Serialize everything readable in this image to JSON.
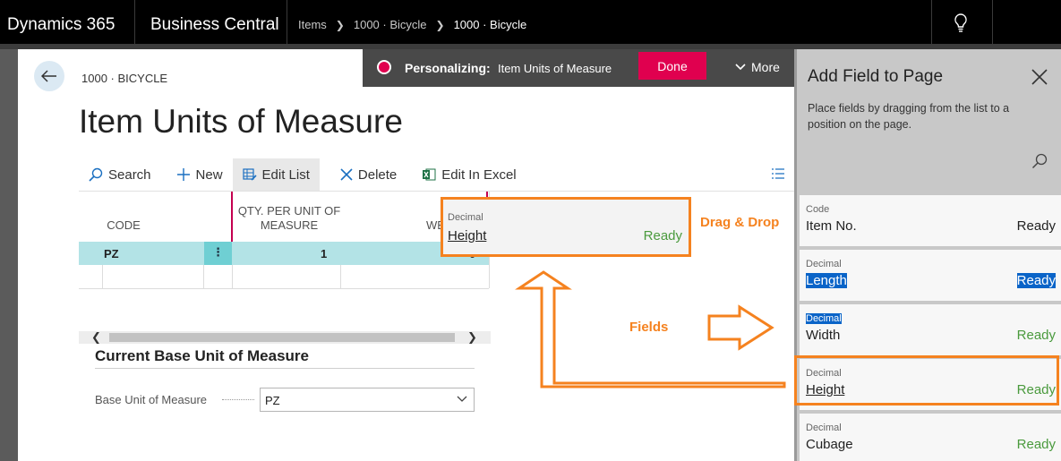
{
  "topbar": {
    "product": "Dynamics 365",
    "app": "Business Central",
    "breadcrumb": [
      "Items",
      "1000 · Bicycle",
      "1000 · Bicycle"
    ]
  },
  "personalize": {
    "label": "Personalizing:",
    "value": "Item Units of Measure",
    "done_label": "Done",
    "more_label": "More"
  },
  "page": {
    "record_id": "1000 · BICYCLE",
    "title": "Item Units of Measure"
  },
  "actions": {
    "search": "Search",
    "new": "New",
    "edit_list": "Edit List",
    "delete": "Delete",
    "edit_excel": "Edit In Excel"
  },
  "grid": {
    "headers": [
      "CODE",
      "QTY. PER UNIT OF MEASURE",
      "WEIGHT"
    ],
    "rows": [
      {
        "code": "PZ",
        "dots": "⋮",
        "qty": "1",
        "weight": "0"
      }
    ]
  },
  "drop_ghost": {
    "type": "Decimal",
    "name": "Height",
    "status": "Ready"
  },
  "fasttab": {
    "title": "Current Base Unit of Measure",
    "base_label": "Base Unit of Measure",
    "base_value": "PZ"
  },
  "panel": {
    "title": "Add Field to Page",
    "description": "Place fields by dragging from the list to a position on the page.",
    "fields": [
      {
        "type": "Code",
        "name": "Item No.",
        "status": "Ready"
      },
      {
        "type": "Decimal",
        "name": "Length",
        "status": "Ready"
      },
      {
        "type": "Decimal",
        "name": "Width",
        "status": "Ready"
      },
      {
        "type": "Decimal",
        "name": "Height",
        "status": "Ready"
      },
      {
        "type": "Decimal",
        "name": "Cubage",
        "status": "Ready"
      }
    ]
  },
  "annotations": {
    "drag_drop": "Drag & Drop",
    "fields": "Fields"
  },
  "colors": {
    "accent": "#e0004f",
    "annotation": "#f5821f",
    "ready_green": "#4a9a3d",
    "selection": "#0a64c8"
  }
}
